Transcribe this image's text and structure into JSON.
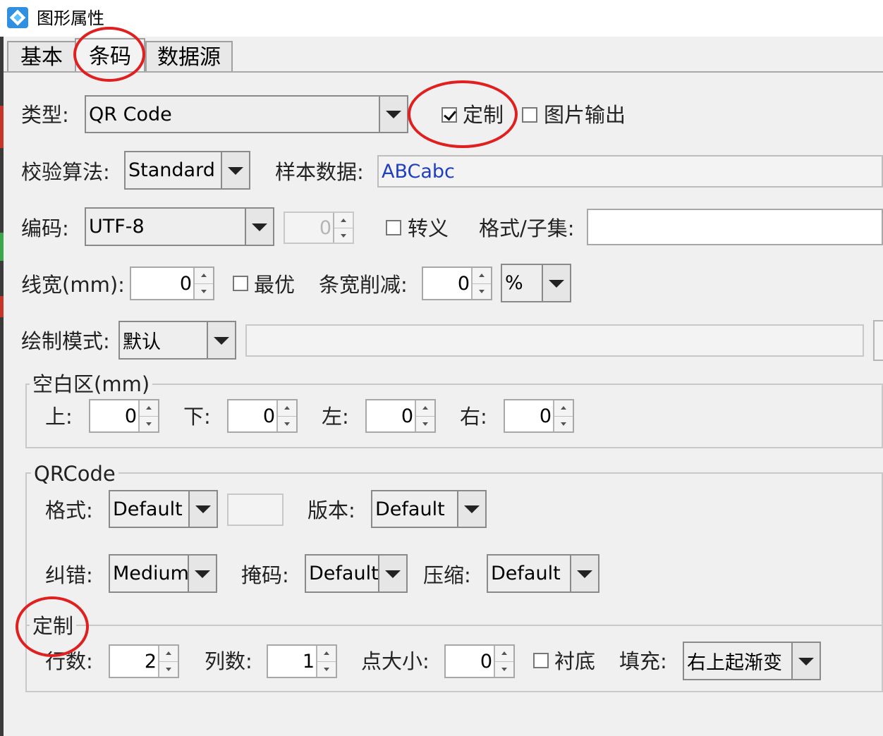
{
  "window": {
    "title": "图形属性"
  },
  "tabs": [
    {
      "label": "基本",
      "active": false
    },
    {
      "label": "条码",
      "active": true
    },
    {
      "label": "数据源",
      "active": false
    }
  ],
  "form": {
    "type_label": "类型:",
    "type_value": "QR Code",
    "custom_label": "定制",
    "custom_checked": true,
    "image_output_label": "图片输出",
    "image_output_checked": false,
    "checksum_label": "校验算法:",
    "checksum_value": "Standard",
    "sample_label": "样本数据:",
    "sample_value": "ABCabc",
    "encoding_label": "编码:",
    "encoding_value": "UTF-8",
    "encoding_spin": "0",
    "escape_label": "转义",
    "escape_checked": false,
    "format_subset_label": "格式/子集:",
    "format_subset_value": "",
    "line_width_label": "线宽(mm):",
    "line_width_value": "0",
    "optimal_label": "最优",
    "optimal_checked": false,
    "bar_reduce_label": "条宽削减:",
    "bar_reduce_value": "0",
    "bar_reduce_unit": "%",
    "draw_mode_label": "绘制模式:",
    "draw_mode_value": "默认",
    "draw_mode_extra": ""
  },
  "quiet_zone": {
    "title": "空白区(mm)",
    "top_label": "上:",
    "top_value": "0",
    "bottom_label": "下:",
    "bottom_value": "0",
    "left_label": "左:",
    "left_value": "0",
    "right_label": "右:",
    "right_value": "0"
  },
  "qrcode": {
    "title": "QRCode",
    "format_label": "格式:",
    "format_value": "Default",
    "format_extra": "",
    "version_label": "版本:",
    "version_value": "Default",
    "ecc_label": "纠错:",
    "ecc_value": "Medium",
    "mask_label": "掩码:",
    "mask_value": "Default",
    "compress_label": "压缩:",
    "compress_value": "Default"
  },
  "custom": {
    "title": "定制",
    "rows_label": "行数:",
    "rows_value": "2",
    "cols_label": "列数:",
    "cols_value": "1",
    "dot_size_label": "点大小:",
    "dot_size_value": "0",
    "background_label": "衬底",
    "background_checked": false,
    "fill_label": "填充:",
    "fill_value": "右上起渐变"
  },
  "colors": {
    "annotation_circle": "#e02020",
    "sample_text": "#1f3fbf",
    "app_icon": "#2f8fe0"
  }
}
